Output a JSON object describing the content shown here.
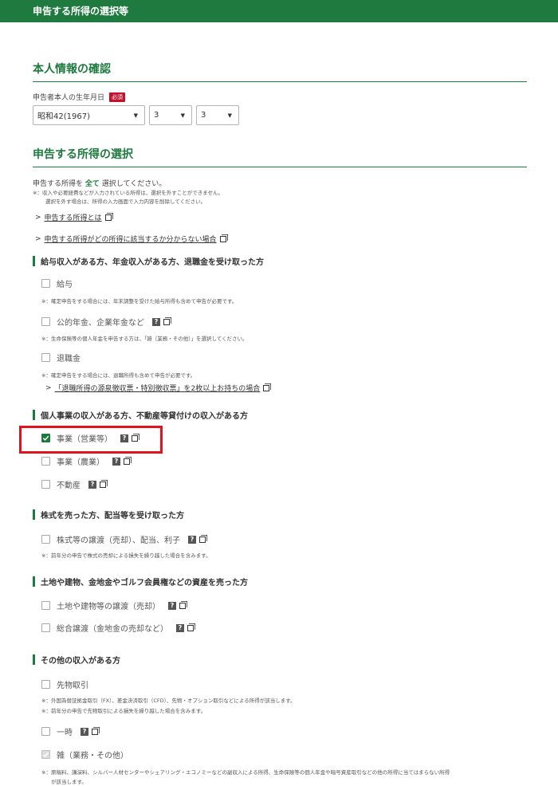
{
  "header": {
    "title": "申告する所得の選択等"
  },
  "personal": {
    "section_title": "本人情報の確認",
    "birth_label": "申告者本人の生年月日",
    "required_badge": "必須",
    "era_year": "昭和42(1967)",
    "month": "3",
    "day": "3"
  },
  "income": {
    "section_title": "申告する所得の選択",
    "intro_prefix": "申告する所得を",
    "intro_highlight": "全て",
    "intro_suffix": "選択してください。",
    "note1": "※：収入や必要経費などが入力されている所得は、選択を外すことができません。",
    "note2": "選択を外す場合は、所得の入力画面で入力内容を削除してください。",
    "link1": "申告する所得とは",
    "link2": "申告する所得がどの所得に該当するか分からない場合"
  },
  "categories": {
    "salary": {
      "heading": "給与収入がある方、年金収入がある方、退職金を受け取った方",
      "item_salary": "給与",
      "note_salary": "※：確定申告をする場合には、年末調整を受けた給与所得も含めて申告が必要です。",
      "item_pension": "公的年金、企業年金など",
      "note_pension": "※：生命保険等の個人年金を申告する方は、「雑（業務・その他）」を選択してください。",
      "item_retirement": "退職金",
      "note_retirement": "※：確定申告をする場合には、退職所得も含めて申告が必要です。",
      "link_retirement": "「退職所得の源泉徴収票・特別徴収票」を2枚以上お持ちの場合"
    },
    "business": {
      "heading": "個人事業の収入がある方、不動産等貸付けの収入がある方",
      "item_business": "事業（営業等）",
      "item_farming": "事業（農業）",
      "item_realestate": "不動産"
    },
    "stocks": {
      "heading": "株式を売った方、配当等を受け取った方",
      "item_stocks": "株式等の譲渡（売却）、配当、利子",
      "note_stocks": "※：前年分の申告で株式の売却による損失を繰り越した場合を含みます。"
    },
    "assets": {
      "heading": "土地や建物、金地金やゴルフ会員権などの資産を売った方",
      "item_land": "土地や建物等の譲渡（売却）",
      "item_general": "総合譲渡（金地金の売却など）"
    },
    "other": {
      "heading": "その他の収入がある方",
      "item_futures": "先物取引",
      "note_futures1": "※：外国為替証拠金取引（FX）、差金決済取引（CFD）、先物・オプション取引などによる所得が該当します。",
      "note_futures2": "※：前年分の申告で先物取引による損失を繰り越した場合を含みます。",
      "item_temporary": "一時",
      "item_misc": "雑（業務・その他）",
      "note_misc1": "※：原稿料、講演料、シルバー人材センターやシェアリング・エコノミーなどの副収入による所得、生命保険等の個人年金や暗号資産取引などの他の所得に当てはまらない所得",
      "note_misc2": "が該当します。"
    }
  },
  "icons": {
    "help": "?",
    "accent": "#1f7a3f",
    "highlight": "#e0141e"
  }
}
